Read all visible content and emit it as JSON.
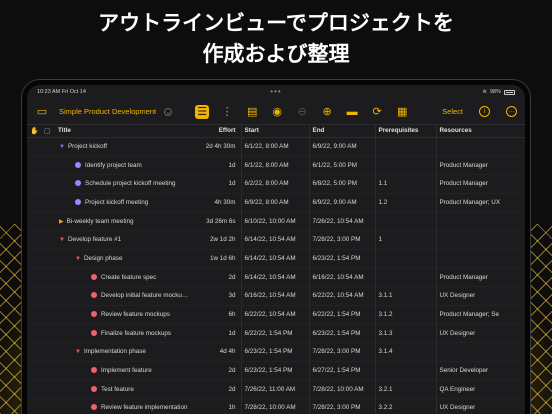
{
  "headline": {
    "line1": "アウトラインビューでプロジェクトを",
    "line2": "作成および整理"
  },
  "status_bar": {
    "time": "10:23 AM",
    "date": "Fri Oct 14",
    "battery": "98%"
  },
  "toolbar": {
    "doc_title": "Simple Product Development",
    "select_label": "Select"
  },
  "columns": {
    "title": "Title",
    "effort": "Effort",
    "start": "Start",
    "end": "End",
    "prerequisites": "Prerequisites",
    "resources": "Resources"
  },
  "rows": [
    {
      "title": "Project kickoff",
      "effort": "2d 4h 30m",
      "start": "6/1/22, 8:00 AM",
      "end": "6/9/22, 9:00 AM",
      "prereq": "",
      "resources": ""
    },
    {
      "title": "Identify project team",
      "effort": "1d",
      "start": "6/1/22, 8:00 AM",
      "end": "6/1/22, 5:00 PM",
      "prereq": "",
      "resources": "Product Manager"
    },
    {
      "title": "Schedule project kickoff meeting",
      "effort": "1d",
      "start": "6/2/22, 8:00 AM",
      "end": "6/8/22, 5:00 PM",
      "prereq": "1.1",
      "resources": "Product Manager"
    },
    {
      "title": "Project kickoff meeting",
      "effort": "4h 30m",
      "start": "6/9/22, 8:00 AM",
      "end": "6/9/22, 9:00 AM",
      "prereq": "1.2",
      "resources": "Product Manager; UX"
    },
    {
      "title": "Bi-weekly team meeting",
      "effort": "3d 26m 6s",
      "start": "6/10/22, 10:00 AM",
      "end": "7/26/22, 10:54 AM",
      "prereq": "",
      "resources": ""
    },
    {
      "title": "Develop feature #1",
      "effort": "2w 1d 2h",
      "start": "6/14/22, 10:54 AM",
      "end": "7/28/22, 3:00 PM",
      "prereq": "1",
      "resources": ""
    },
    {
      "title": "Design phase",
      "effort": "1w 1d 6h",
      "start": "6/14/22, 10:54 AM",
      "end": "6/23/22, 1:54 PM",
      "prereq": "",
      "resources": ""
    },
    {
      "title": "Create feature spec",
      "effort": "2d",
      "start": "6/14/22, 10:54 AM",
      "end": "6/16/22, 10:54 AM",
      "prereq": "",
      "resources": "Product Manager"
    },
    {
      "title": "Develop initial feature mocku…",
      "effort": "3d",
      "start": "6/16/22, 10:54 AM",
      "end": "6/22/22, 10:54 AM",
      "prereq": "3.1.1",
      "resources": "UX Designer"
    },
    {
      "title": "Review feature mockups",
      "effort": "6h",
      "start": "6/22/22, 10:54 AM",
      "end": "6/22/22, 1:54 PM",
      "prereq": "3.1.2",
      "resources": "Product Manager; Se"
    },
    {
      "title": "Finalize feature mockups",
      "effort": "1d",
      "start": "6/22/22, 1:54 PM",
      "end": "6/23/22, 1:54 PM",
      "prereq": "3.1.3",
      "resources": "UX Designer"
    },
    {
      "title": "Implementation phase",
      "effort": "4d 4h",
      "start": "6/23/22, 1:54 PM",
      "end": "7/28/22, 3:00 PM",
      "prereq": "3.1.4",
      "resources": ""
    },
    {
      "title": "Implement feature",
      "effort": "2d",
      "start": "6/23/22, 1:54 PM",
      "end": "6/27/22, 1:54 PM",
      "prereq": "",
      "resources": "Senior Developer"
    },
    {
      "title": "Test feature",
      "effort": "2d",
      "start": "7/26/22, 11:00 AM",
      "end": "7/28/22, 10:00 AM",
      "prereq": "3.2.1",
      "resources": "QA Engineer"
    },
    {
      "title": "Review feature implementation",
      "effort": "1h",
      "start": "7/28/22, 10:00 AM",
      "end": "7/28/22, 3:00 PM",
      "prereq": "3.2.2",
      "resources": "UX Designer"
    }
  ],
  "colors": {
    "accent": "#f0b400",
    "group_marker": "#ff5a4d",
    "task_blue": "#8e8eff",
    "task_red": "#f25f67"
  }
}
